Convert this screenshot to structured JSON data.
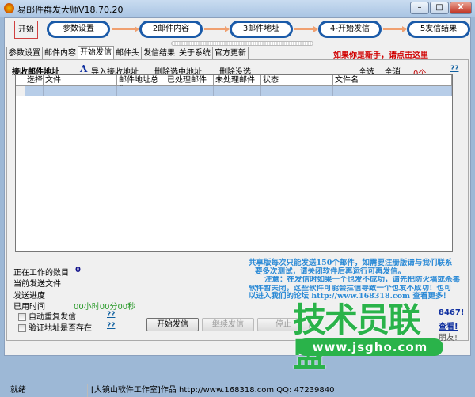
{
  "window": {
    "title": "易邮件群发大师V18.70.20",
    "minimize": "–",
    "maximize": "□",
    "close": "X"
  },
  "workflow": {
    "start": "开始",
    "steps": [
      "参数设置",
      "2邮件内容",
      "3邮件地址",
      "4-开始发信",
      "5发信结果"
    ]
  },
  "tabs": [
    "参数设置",
    "邮件内容",
    "开始发信",
    "邮件头",
    "发信结果",
    "关于系统",
    "官方更新"
  ],
  "active_tab": "开始发信",
  "newbie_link": "如果你是新手，请点击这里",
  "toolbar": {
    "section_label": "接收邮件地址",
    "import_icon": "A",
    "import": "导入接收地址",
    "delete_selected": "删除选中地址",
    "delete_unselected": "删除没选",
    "select_all": "全选",
    "select_none": "全消",
    "count": "0个",
    "help": "??"
  },
  "grid": {
    "columns": [
      "选择",
      "文件",
      "邮件地址总数",
      "已处理邮件",
      "未处理邮件",
      "状态",
      "文件名"
    ]
  },
  "progress": {
    "working_count_label": "正在工作的数目",
    "working_count": "0",
    "current_file_label": "当前发送文件",
    "progress_label": "发送进度",
    "elapsed_label": "已用时间",
    "elapsed": "00小时00分00秒"
  },
  "options": [
    {
      "label": "自动重复发信",
      "checked": false,
      "help": "??"
    },
    {
      "label": "验证地址是否存在",
      "checked": false,
      "help": "??"
    }
  ],
  "buttons": {
    "start": "开始发信",
    "continue": "继续发信",
    "stop": "停止"
  },
  "notice": [
    "共享版每次只能发送150个邮件，如需要注册版请与我们联系",
    "要多次测试，请关闭软件后再运行可再发信。",
    "注意：在发信时如果一个也发不成功，请先把防火墙或杀毒",
    "软件暂关闭，这些软件可能会拦信导致一个也发不成功！也可",
    "以进入我们的论坛 http://www.168318.com 查看更多！"
  ],
  "bottom_links": [
    "8467!",
    "查看!",
    "朋友!"
  ],
  "statusbar": {
    "state": "就绪",
    "credit": "[大镜山软件工作室]作品 http://www.168318.com QQ: 47239840"
  },
  "watermark": {
    "text": "技术员联盟",
    "url": "www.jsgho.com",
    "color": "#2ab34a"
  }
}
